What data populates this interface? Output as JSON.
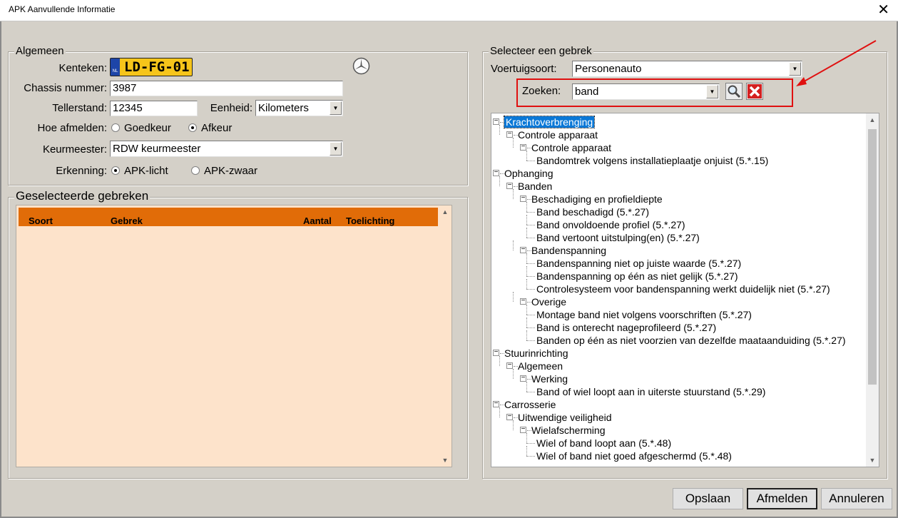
{
  "window": {
    "title": "APK Aanvullende Informatie",
    "close_glyph": "✕"
  },
  "algemeen": {
    "legend": "Algemeen",
    "kenteken_label": "Kenteken:",
    "kenteken_value": "LD-FG-01",
    "plate_country": "NL",
    "chassis_label": "Chassis nummer:",
    "chassis_value": "3987",
    "tellerstand_label": "Tellerstand:",
    "tellerstand_value": "12345",
    "eenheid_label": "Eenheid:",
    "eenheid_value": "Kilometers",
    "afmelden_label": "Hoe afmelden:",
    "afmelden_options": [
      "Goedkeur",
      "Afkeur"
    ],
    "afmelden_selected": "Afkeur",
    "keurmeester_label": "Keurmeester:",
    "keurmeester_value": "RDW keurmeester",
    "erkenning_label": "Erkenning:",
    "erkenning_options": [
      "APK-licht",
      "APK-zwaar"
    ],
    "erkenning_selected": "APK-licht",
    "brand_icon": "mercedes-logo-icon"
  },
  "gebreken": {
    "legend": "Geselecteerde gebreken",
    "columns": [
      "Soort",
      "Gebrek",
      "Aantal",
      "Toelichting"
    ],
    "rows": []
  },
  "selecteer": {
    "legend": "Selecteer een gebrek",
    "voertuigsoort_label": "Voertuigsoort:",
    "voertuigsoort_value": "Personenauto",
    "zoeken_label": "Zoeken:",
    "zoeken_value": "band",
    "search_icon": "magnifier-icon",
    "clear_icon": "red-x-icon",
    "tree": [
      {
        "level": 0,
        "text": "Krachtoverbrenging",
        "expander": "-",
        "selected": true
      },
      {
        "level": 1,
        "text": "Controle apparaat",
        "expander": "-"
      },
      {
        "level": 2,
        "text": "Controle apparaat",
        "expander": "-"
      },
      {
        "level": 3,
        "text": "Bandomtrek volgens installatieplaatje onjuist (5.*.15)"
      },
      {
        "level": 0,
        "text": "Ophanging",
        "expander": "-"
      },
      {
        "level": 1,
        "text": "Banden",
        "expander": "-"
      },
      {
        "level": 2,
        "text": "Beschadiging en profieldiepte",
        "expander": "-"
      },
      {
        "level": 3,
        "text": "Band beschadigd (5.*.27)"
      },
      {
        "level": 3,
        "text": "Band onvoldoende profiel (5.*.27)"
      },
      {
        "level": 3,
        "text": "Band vertoont uitstulping(en) (5.*.27)"
      },
      {
        "level": 2,
        "text": "Bandenspanning",
        "expander": "-"
      },
      {
        "level": 3,
        "text": "Bandenspanning niet op juiste waarde (5.*.27)"
      },
      {
        "level": 3,
        "text": "Bandenspanning op één as niet gelijk (5.*.27)"
      },
      {
        "level": 3,
        "text": "Controlesysteem voor bandenspanning werkt duidelijk niet (5.*.27)"
      },
      {
        "level": 2,
        "text": "Overige",
        "expander": "-"
      },
      {
        "level": 3,
        "text": "Montage band niet volgens voorschriften (5.*.27)"
      },
      {
        "level": 3,
        "text": "Band is onterecht nageprofileerd (5.*.27)"
      },
      {
        "level": 3,
        "text": "Banden op één as niet voorzien van dezelfde maataanduiding (5.*.27)"
      },
      {
        "level": 0,
        "text": "Stuurinrichting",
        "expander": "-"
      },
      {
        "level": 1,
        "text": "Algemeen",
        "expander": "-"
      },
      {
        "level": 2,
        "text": "Werking",
        "expander": "-"
      },
      {
        "level": 3,
        "text": "Band of wiel loopt aan in uiterste stuurstand (5.*.29)"
      },
      {
        "level": 0,
        "text": "Carrosserie",
        "expander": "-"
      },
      {
        "level": 1,
        "text": "Uitwendige veiligheid",
        "expander": "-"
      },
      {
        "level": 2,
        "text": "Wielafscherming",
        "expander": "-"
      },
      {
        "level": 3,
        "text": "Wiel of band loopt aan (5.*.48)"
      },
      {
        "level": 3,
        "text": "Wiel of band niet goed afgeschermd (5.*.48)"
      }
    ],
    "tree_scroll_fraction": 0.78
  },
  "buttons": {
    "opslaan": "Opslaan",
    "afmelden": "Afmelden",
    "annuleren": "Annuleren"
  },
  "colors": {
    "grid_header": "#e16c08",
    "grid_body": "#fde3cb",
    "selection": "#0a78d7",
    "callout": "#e01010",
    "plate": "#f6c51a"
  }
}
